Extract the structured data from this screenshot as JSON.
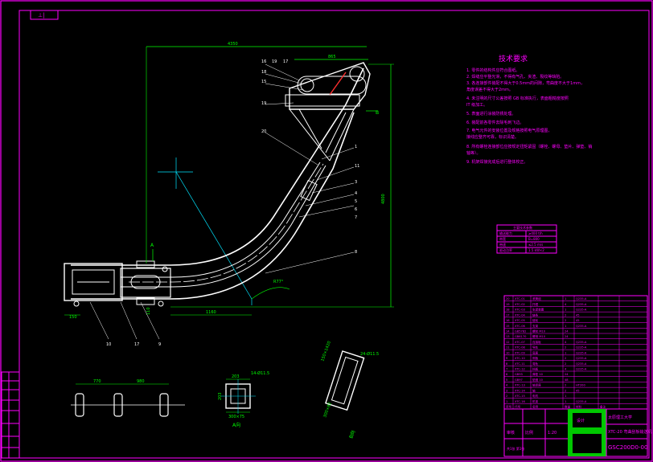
{
  "drawing": {
    "top_left_mark": "⊥|",
    "requirements": {
      "title": "技术要求",
      "items": [
        "1. 零件的结构件应符合图纸。",
        "2. 焊缝应平整光滑，不得有气孔、夹渣、裂纹等缺陷。",
        "3. 各连接部件装配不得大于0.5mm的间隙，弯曲度不大于1mm，",
        "   角度误差不得大于2mm。",
        "4. 未注明的尺寸公差按照 GB 标准执行，表面粗糙度按照",
        "   IT 级加工。",
        "5. 表面进行涂装防锈处理。",
        "6. 装配前各零件去除毛刺飞边。",
        "7. 电气元件的安装位置及规格按照电气原理图，",
        "   接线应整齐可靠，标识清楚。",
        "8. 所有螺栓连接部位应按规定扭矩紧固（螺栓、螺母、垫片、弹垫、销",
        "   轴等）。",
        "9. 机架焊接完成后进行整体校正。"
      ]
    },
    "dimensions": {
      "overall_width": "4350",
      "top_width": "865",
      "height": "4800",
      "arc_angle": "R77°",
      "bottom_length": "1160",
      "left_dim": "150",
      "right_dim": "110",
      "section_a_width": "203",
      "section_a_bottom": "300×75",
      "section_a_side": "203",
      "section_a_holes": "14-Ø11.5",
      "section_b_width": "150×1420",
      "section_b_side": "300×82",
      "section_b_holes": "24-Ø11.5",
      "elev_left": "770",
      "elev_right": "980"
    },
    "callouts_top": [
      "16",
      "19",
      "17",
      "18",
      "15",
      "19",
      "20"
    ],
    "callouts_right": [
      "1",
      "11",
      "3",
      "4",
      "5",
      "6",
      "7",
      "8"
    ],
    "callouts_bottom": [
      "10",
      "17",
      "9"
    ],
    "section_marks": {
      "a_top": "A",
      "a_label": "A向",
      "b_top": "B",
      "b_label": "B向"
    },
    "small_table": {
      "rows": [
        [
          "主要技术参数",
          ""
        ],
        [
          "输送能力",
          "≥400 t/h"
        ],
        [
          "带宽",
          "B=800"
        ],
        [
          "带速",
          "≤2.5 m/s"
        ],
        [
          "驱动功率",
          "1.5 kW×2"
        ]
      ]
    },
    "bom": {
      "rows": [
        [
          "20",
          "XTC-01",
          "滚筒组",
          "1",
          "Q235-A",
          ""
        ],
        [
          "19",
          "XTC-02",
          "托辊",
          "4",
          "Q235-A",
          ""
        ],
        [
          "18",
          "XTC-03",
          "张紧装置",
          "1",
          "Q235-A",
          ""
        ],
        [
          "17",
          "XTC-04",
          "链条",
          "2",
          "45",
          ""
        ],
        [
          "16",
          "XTC-05",
          "链轮",
          "2",
          "45",
          ""
        ],
        [
          "15",
          "XTC-06",
          "支架",
          "1",
          "Q235-A",
          ""
        ],
        [
          "14",
          "GB5782",
          "螺栓 M10",
          "24",
          "",
          ""
        ],
        [
          "13",
          "GB6170",
          "螺母 M10",
          "24",
          "",
          ""
        ],
        [
          "12",
          "XTC-07",
          "连接板",
          "4",
          "Q235-A",
          ""
        ],
        [
          "11",
          "XTC-08",
          "导轨",
          "2",
          "Q235-A",
          ""
        ],
        [
          "10",
          "XTC-09",
          "底座",
          "1",
          "Q235-A",
          ""
        ],
        [
          "9",
          "XTC-10",
          "侧板",
          "2",
          "Q235-A",
          ""
        ],
        [
          "8",
          "XTC-11",
          "弯轨",
          "2",
          "Q235-A",
          ""
        ],
        [
          "7",
          "XTC-12",
          "挡板",
          "4",
          "Q235-A",
          ""
        ],
        [
          "6",
          "GB93",
          "弹垫 10",
          "24",
          "",
          ""
        ],
        [
          "5",
          "GB97",
          "垫圈 10",
          "48",
          "",
          ""
        ],
        [
          "4",
          "XTC-13",
          "轴承座",
          "2",
          "HT200",
          ""
        ],
        [
          "3",
          "XTC-14",
          "轴",
          "2",
          "45",
          ""
        ],
        [
          "2",
          "XTC-15",
          "电机",
          "1",
          "",
          ""
        ],
        [
          "1",
          "XTC-16",
          "机架",
          "1",
          "Q235-A",
          ""
        ]
      ],
      "header": [
        "序号",
        "代号",
        "名称",
        "数量",
        "材料",
        "备注"
      ]
    },
    "title_block": {
      "company": "太原理工大学",
      "name": "XTC-20 弯曲刮板输送机",
      "drawing_no": "GSC200D0-00",
      "label_design": "设计",
      "label_check": "审核",
      "label_scale": "比例",
      "scale": "1:20",
      "label_sheet": "共1张 第1张"
    },
    "colors": {
      "frame": "#ff00ff",
      "dimension": "#00ff00",
      "geometry": "#ffffff",
      "centerline": "#00e5ff",
      "highlight": "#ff3030"
    }
  }
}
